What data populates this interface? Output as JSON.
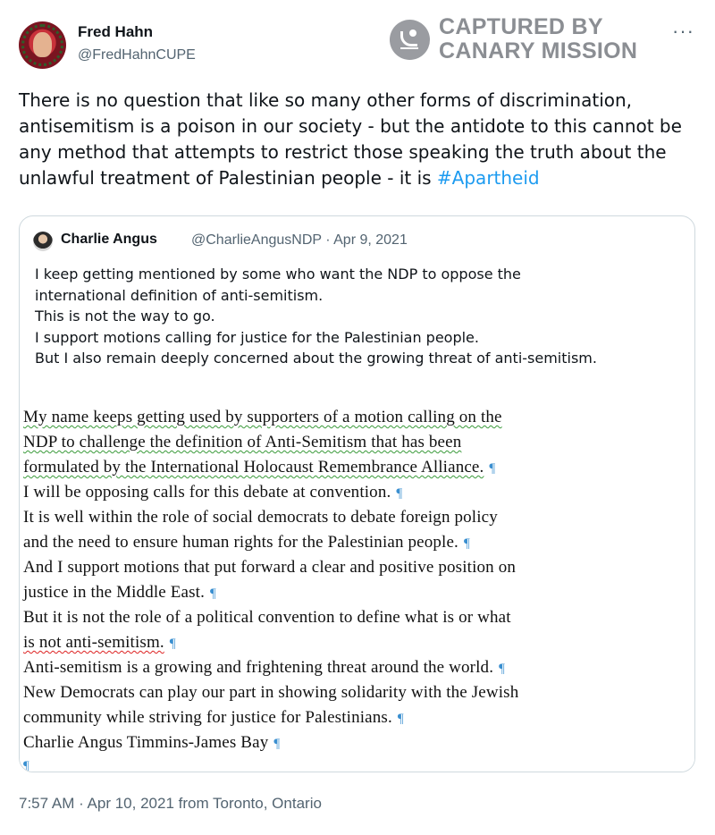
{
  "author": {
    "display_name": "Fred Hahn",
    "handle": "@FredHahnCUPE"
  },
  "watermark": {
    "line1": "CAPTURED BY",
    "line2": "CANARY MISSION"
  },
  "more_icon": "···",
  "tweet": {
    "text": "There is no question that like so many other forms of discrimination, antisemitism is a poison in our society - but the antidote to this cannot be any method that attempts to restrict those speaking the truth about the unlawful treatment of Palestinian people - it is ",
    "hashtag": "#Apartheid"
  },
  "quote": {
    "display_name": "Charlie Angus",
    "meta": "@CharlieAngusNDP · Apr 9, 2021",
    "lines": [
      "I keep getting mentioned by some who want the NDP to oppose the",
      "international definition of anti-semitism.",
      "This is not the way to go.",
      "I support motions calling for justice for the Palestinian people.",
      "But I also remain deeply concerned about the growing threat of anti-semitism."
    ],
    "document_lines": [
      "My name keeps getting used by supporters of a motion calling on the",
      "NDP to challenge the definition of Anti-Semitism that has been",
      "formulated by the International Holocaust Remembrance Alliance.",
      "I will be opposing calls for this debate at convention.",
      "It is well within the role of social democrats to debate foreign policy",
      "and the need to ensure human rights for the Palestinian people.",
      "And I support motions that put forward a clear and positive position on",
      "justice in the Middle East.",
      "But it is not the role of a political convention to define what is or what",
      "is not anti-semitism.",
      "Anti-semitism is a growing and frightening threat around the world.",
      "New Democrats can play our part in showing solidarity with the Jewish",
      "community while striving for justice for Palestinians.",
      "Charlie Angus Timmins-James Bay"
    ],
    "pilcrow": "¶"
  },
  "footer": {
    "timestamp": "7:57 AM · Apr 10, 2021 from Toronto, Ontario"
  },
  "colors": {
    "link": "#1d9bf0",
    "secondary_text": "#536471",
    "border": "#cfd9de",
    "watermark": "#8b8e93"
  }
}
